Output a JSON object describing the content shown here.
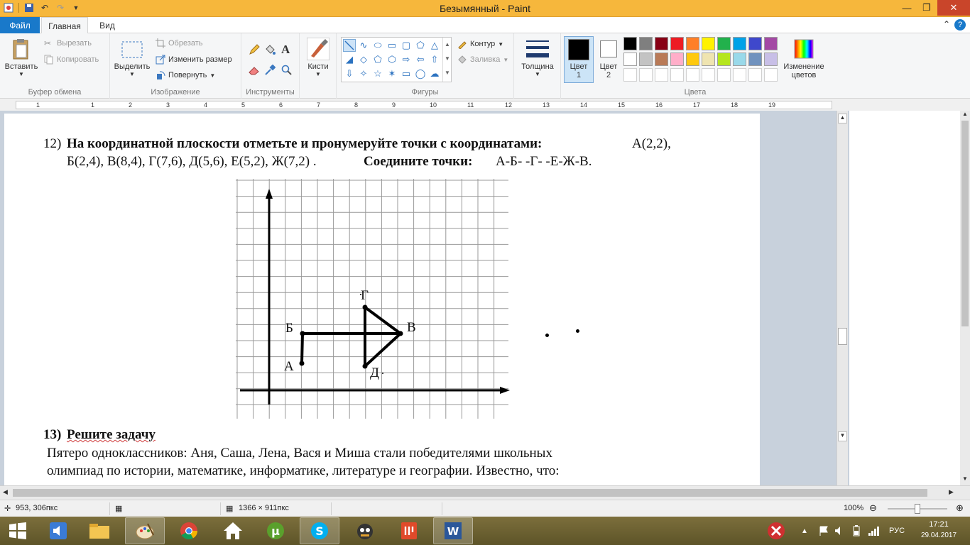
{
  "window": {
    "title": "Безымянный - Paint"
  },
  "tabs": {
    "file": "Файл",
    "home": "Главная",
    "view": "Вид"
  },
  "ribbon": {
    "clipboard": {
      "paste": "Вставить",
      "cut": "Вырезать",
      "copy": "Копировать",
      "label": "Буфер обмена"
    },
    "image": {
      "select": "Выделить",
      "crop": "Обрезать",
      "resize": "Изменить размер",
      "rotate": "Повернуть",
      "label": "Изображение"
    },
    "tools": {
      "label": "Инструменты"
    },
    "brushes": {
      "label": "Кисти"
    },
    "shapes": {
      "outline": "Контур",
      "fill": "Заливка",
      "label": "Фигуры"
    },
    "size": {
      "label": "Толщина"
    },
    "colors": {
      "color1_line1": "Цвет",
      "color1_line2": "1",
      "color2_line1": "Цвет",
      "color2_line2": "2",
      "edit_line1": "Изменение",
      "edit_line2": "цветов",
      "label": "Цвета",
      "color1": "#000000",
      "color2": "#ffffff",
      "palette_row1": [
        "#000000",
        "#7f7f7f",
        "#880015",
        "#ed1c24",
        "#ff7f27",
        "#fff200",
        "#22b14c",
        "#00a2e8",
        "#3f48cc",
        "#a349a4"
      ],
      "palette_row2": [
        "#ffffff",
        "#c3c3c3",
        "#b97a57",
        "#ffaec9",
        "#ffc90e",
        "#efe4b0",
        "#b5e61d",
        "#99d9ea",
        "#7092be",
        "#c8bfe7"
      ]
    }
  },
  "ruler": {
    "numbers": [
      "1",
      "1",
      "2",
      "3",
      "4",
      "5",
      "6",
      "7",
      "8",
      "9",
      "10",
      "11",
      "12",
      "13",
      "14",
      "15",
      "16",
      "17",
      "18",
      "19"
    ]
  },
  "document": {
    "q12_num": "12)",
    "q12_line1": "На координатной плоскости отметьте  и пронумеруйте  точки с координатами:",
    "q12_line1_coords": "А(2,2),",
    "q12_line2a": "Б(2,4), В(8,4), Г(7,6), Д(5,6), Е(5,2), Ж(7,2) .",
    "q12_line2b": "Соедините точки:",
    "q12_line2c": "А-Б-   -Г-   -Е-Ж-В.",
    "labels": {
      "A": "А",
      "B": "Б",
      "V": "В",
      "G": "Г",
      "D": "Д"
    },
    "q13_num": "13)",
    "q13_title": "Решите задачу",
    "q13_line1": "Пятеро  одноклассников:  Аня,  Саша,  Лена,  Вася  и  Миша  стали  победителями  школьных",
    "q13_line2": "олимпиад по истории, математике, информатике, литературе и географии. Известно, что:"
  },
  "status": {
    "cursor": "953, 306пкс",
    "size": "1366 × 911пкс",
    "zoom": "100%"
  },
  "taskbar": {
    "tray_lang": "РУС",
    "time": "17:21",
    "date": "29.04.2017"
  }
}
